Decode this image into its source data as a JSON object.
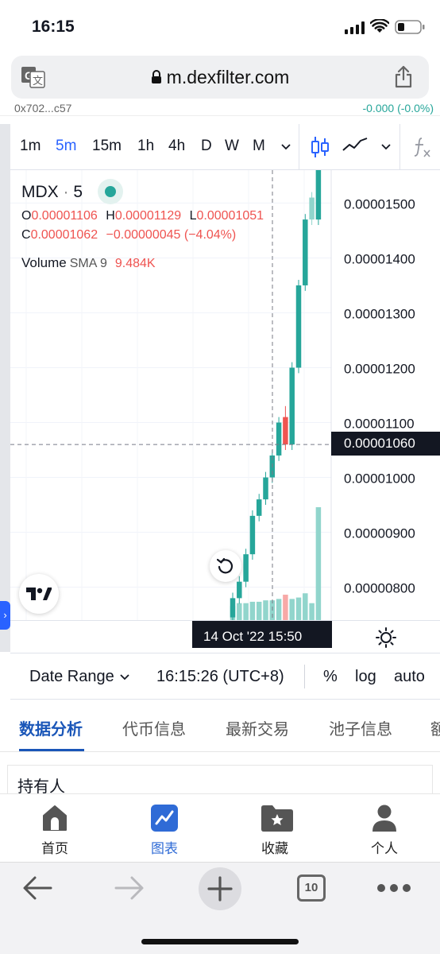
{
  "status": {
    "time": "16:15"
  },
  "browser": {
    "url": "m.dexfilter.com",
    "tab_count": "10"
  },
  "partial_row": {
    "left": "0x702...c57",
    "right": "-0.000 (-0.0%)"
  },
  "toolbar": {
    "timeframes": [
      "1m",
      "5m",
      "15m",
      "1h",
      "4h",
      "D",
      "W",
      "M"
    ],
    "active_timeframe": "5m"
  },
  "legend": {
    "symbol": "MDX",
    "interval": "5",
    "o_label": "O",
    "o_value": "0.00001106",
    "h_label": "H",
    "h_value": "0.00001129",
    "l_label": "L",
    "l_value": "0.00001051",
    "c_label": "C",
    "c_value": "0.00001062",
    "change": "−0.00000045 (−4.04%)",
    "volume_label": "Volume",
    "sma_label": "SMA 9",
    "volume_value": "9.484K"
  },
  "price_axis": {
    "ticks": [
      "0.00001500",
      "0.00001400",
      "0.00001300",
      "0.00001200",
      "0.00001100",
      "0.00001000",
      "0.00000900",
      "0.00000800"
    ],
    "current_price": "0.00001060"
  },
  "crosshair": {
    "time_label": "14 Oct '22   15:50"
  },
  "bottom_controls": {
    "date_range": "Date Range",
    "clock": "16:15:26 (UTC+8)",
    "percent": "%",
    "log": "log",
    "auto": "auto"
  },
  "tabs": [
    "数据分析",
    "代币信息",
    "最新交易",
    "池子信息",
    "额"
  ],
  "active_tab": "数据分析",
  "holder_title": "持有人",
  "nav": [
    {
      "label": "首页",
      "icon": "home-icon"
    },
    {
      "label": "图表",
      "icon": "chart-icon"
    },
    {
      "label": "收藏",
      "icon": "favorites-folder-icon"
    },
    {
      "label": "个人",
      "icon": "user-icon"
    }
  ],
  "colors": {
    "up": "#26a69a",
    "down": "#ef5350",
    "accent": "#2962ff",
    "tab_active": "#1a56b8"
  },
  "chart_data": {
    "type": "candlestick",
    "symbol": "MDX",
    "interval": "5",
    "ylim": [
      7.4e-06,
      1.56e-05
    ],
    "price_ticks": [
      1.5e-05,
      1.4e-05,
      1.3e-05,
      1.2e-05,
      1.1e-05,
      1e-05,
      9e-06,
      8e-06
    ],
    "current_price": 1.06e-05,
    "candles": [
      {
        "o": 7.45e-06,
        "h": 7.9e-06,
        "l": 7.4e-06,
        "c": 7.8e-06
      },
      {
        "o": 7.8e-06,
        "h": 8.2e-06,
        "l": 7.7e-06,
        "c": 8.1e-06
      },
      {
        "o": 8.1e-06,
        "h": 8.7e-06,
        "l": 8e-06,
        "c": 8.6e-06
      },
      {
        "o": 8.6e-06,
        "h": 9.4e-06,
        "l": 8.5e-06,
        "c": 9.3e-06
      },
      {
        "o": 9.3e-06,
        "h": 9.7e-06,
        "l": 9.2e-06,
        "c": 9.6e-06
      },
      {
        "o": 9.6e-06,
        "h": 1.01e-05,
        "l": 9.5e-06,
        "c": 1e-05
      },
      {
        "o": 1e-05,
        "h": 1.05e-05,
        "l": 9.9e-06,
        "c": 1.04e-05
      },
      {
        "o": 1.04e-05,
        "h": 1.11e-05,
        "l": 1.03e-05,
        "c": 1.1e-05
      },
      {
        "o": 1.11e-05,
        "h": 1.13e-05,
        "l": 1.05e-05,
        "c": 1.06e-05
      },
      {
        "o": 1.06e-05,
        "h": 1.21e-05,
        "l": 1.05e-05,
        "c": 1.2e-05
      },
      {
        "o": 1.2e-05,
        "h": 1.36e-05,
        "l": 1.19e-05,
        "c": 1.35e-05
      },
      {
        "o": 1.35e-05,
        "h": 1.48e-05,
        "l": 1.34e-05,
        "c": 1.47e-05
      },
      {
        "o": 1.51e-05,
        "h": 1.52e-05,
        "l": 1.46e-05,
        "c": 1.47e-05
      },
      {
        "o": 1.47e-05,
        "h": 1.56e-05,
        "l": 1.46e-05,
        "c": 1.56e-05
      }
    ],
    "volumes": [
      0.5,
      0.6,
      0.6,
      0.65,
      0.65,
      0.7,
      0.7,
      0.75,
      0.9,
      0.75,
      0.8,
      0.95,
      0.6,
      4.0
    ],
    "volume_colors": [
      "up",
      "up",
      "up",
      "up",
      "up",
      "up",
      "up",
      "up",
      "down",
      "up",
      "up",
      "up",
      "up",
      "up"
    ]
  }
}
